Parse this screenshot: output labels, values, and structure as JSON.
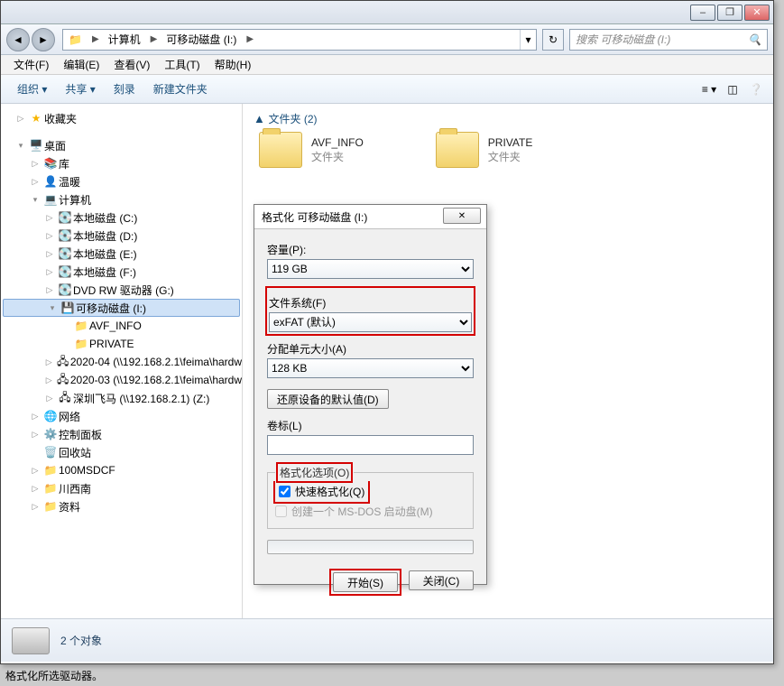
{
  "windowButtons": {
    "min": "–",
    "max": "❐",
    "close": "✕"
  },
  "nav": {
    "back": "◄",
    "forward": "►",
    "refresh": "↻",
    "computer": "计算机",
    "drive": "可移动磁盘 (I:)",
    "searchPlaceholder": "搜索 可移动磁盘 (I:)"
  },
  "menu": {
    "file": "文件(F)",
    "edit": "编辑(E)",
    "view": "查看(V)",
    "tools": "工具(T)",
    "help": "帮助(H)"
  },
  "toolbar": {
    "organize": "组织 ▾",
    "share": "共享 ▾",
    "burn": "刻录",
    "newfolder": "新建文件夹"
  },
  "sidebar": {
    "favorites": "收藏夹",
    "desktop": "桌面",
    "libraries": "库",
    "wennuan": "温暖",
    "computer": "计算机",
    "drives": [
      "本地磁盘 (C:)",
      "本地磁盘 (D:)",
      "本地磁盘 (E:)",
      "本地磁盘 (F:)",
      "DVD RW 驱动器 (G:)"
    ],
    "removable": "可移动磁盘 (I:)",
    "removableChildren": [
      "AVF_INFO",
      "PRIVATE"
    ],
    "netDrives": [
      "2020-04 (\\\\192.168.2.1\\feima\\hardw",
      "2020-03 (\\\\192.168.2.1\\feima\\hardw",
      "深圳飞马 (\\\\192.168.2.1) (Z:)"
    ],
    "network": "网络",
    "controlPanel": "控制面板",
    "recycle": "回收站",
    "extra": [
      "100MSDCF",
      "川西南",
      "资料"
    ]
  },
  "content": {
    "sectionLabel": "文件夹 (2)",
    "folders": [
      {
        "name": "AVF_INFO",
        "type": "文件夹"
      },
      {
        "name": "PRIVATE",
        "type": "文件夹"
      }
    ]
  },
  "status": {
    "count": "2 个对象"
  },
  "dialog": {
    "title": "格式化 可移动磁盘 (I:)",
    "close": "✕",
    "capacityLabel": "容量(P):",
    "capacity": "119 GB",
    "fsLabel": "文件系统(F)",
    "fs": "exFAT (默认)",
    "clusterLabel": "分配单元大小(A)",
    "cluster": "128 KB",
    "restoreDefaults": "还原设备的默认值(D)",
    "volLabel": "卷标(L)",
    "volume": "",
    "optionsLegend": "格式化选项(O)",
    "quickFormat": "快速格式化(Q)",
    "msdos": "创建一个 MS-DOS 启动盘(M)",
    "start": "开始(S)",
    "closeBtn": "关闭(C)"
  },
  "annotation": "格式化所选驱动器。"
}
